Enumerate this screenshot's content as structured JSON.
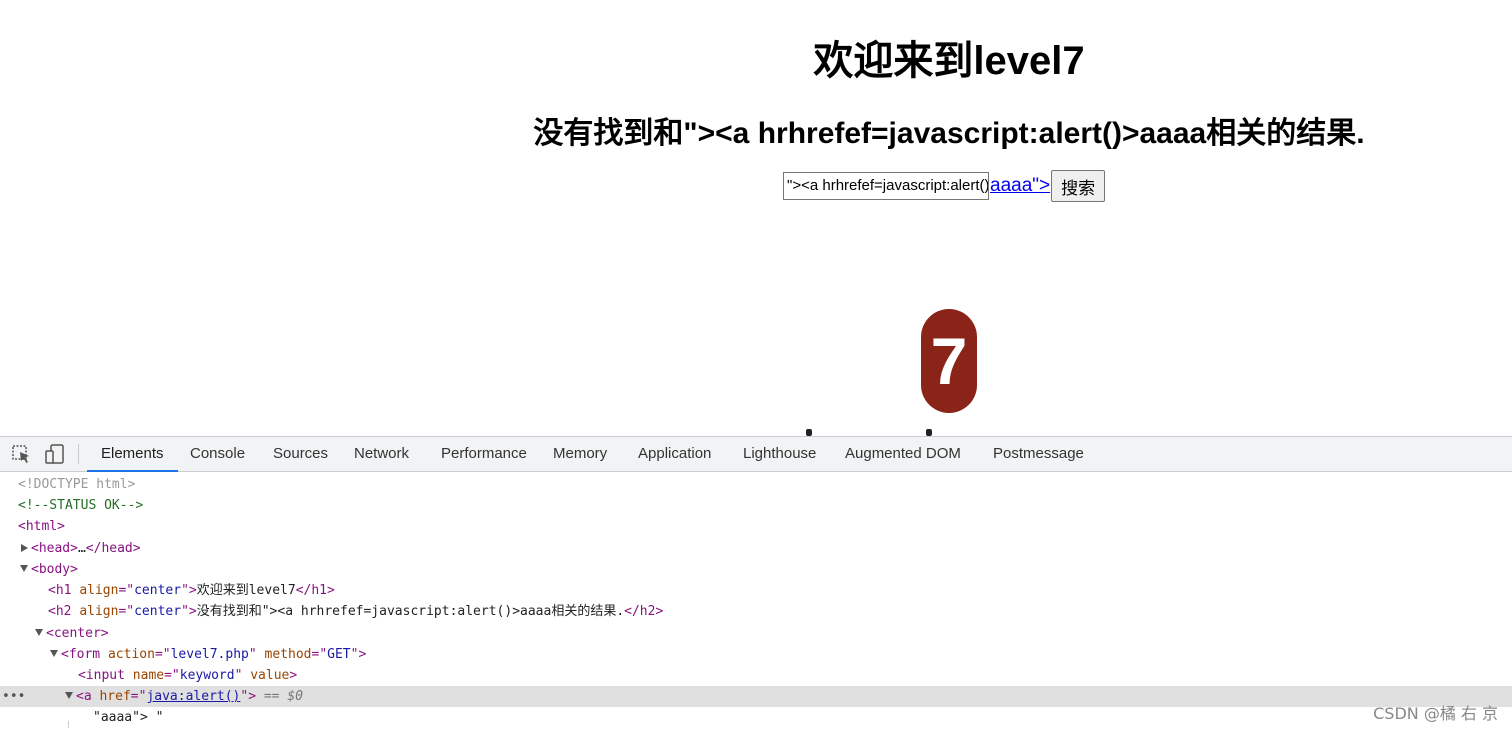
{
  "page": {
    "h1": "欢迎来到level7",
    "h2": "没有找到和\"><a hrhrefef=javascript:alert()>aaaa相关的结果.",
    "keyword_value": "\"><a hrhrefef=javascript:alert()>aaaa",
    "link_text": "aaaa\">",
    "search_button": "搜索",
    "logo_number": "7"
  },
  "devtools": {
    "tabs": [
      "Elements",
      "Console",
      "Sources",
      "Network",
      "Performance",
      "Memory",
      "Application",
      "Lighthouse",
      "Augmented DOM",
      "Postmessage"
    ],
    "active_tab": "Elements",
    "lines": {
      "doctype": "<!DOCTYPE html>",
      "comment": "<!--STATUS OK-->",
      "html_open": "<html>",
      "head": {
        "open": "<head>",
        "ellipsis": "…",
        "close": "</head>"
      },
      "body_open": "<body>",
      "h1": {
        "open": "<h1 ",
        "attr": "align",
        "eq": "=\"",
        "val": "center",
        "close_q": "\">",
        "text": "欢迎来到level7",
        "end": "</h1>"
      },
      "h2": {
        "open": "<h2 ",
        "attr": "align",
        "eq": "=\"",
        "val": "center",
        "close_q": "\">",
        "text": "没有找到和\"><a hrhrefef=javascript:alert()>aaaa相关的结果.",
        "end": "</h2>"
      },
      "center_open": "<center>",
      "form": {
        "open": "<form ",
        "a1": "action",
        "v1": "level7.php",
        "a2": "method",
        "v2": "GET",
        "close": ">"
      },
      "input": {
        "open": "<input ",
        "a1": "name",
        "v1": "keyword",
        "a2": "value",
        "close": ">"
      },
      "anchor": {
        "open": "<a ",
        "attr": "href",
        "val": "java:alert()",
        "close": ">",
        "eq_ref": "== $0"
      },
      "text_node": "\"aaaa\"> \""
    }
  },
  "watermark": "CSDN @橘 右 京"
}
